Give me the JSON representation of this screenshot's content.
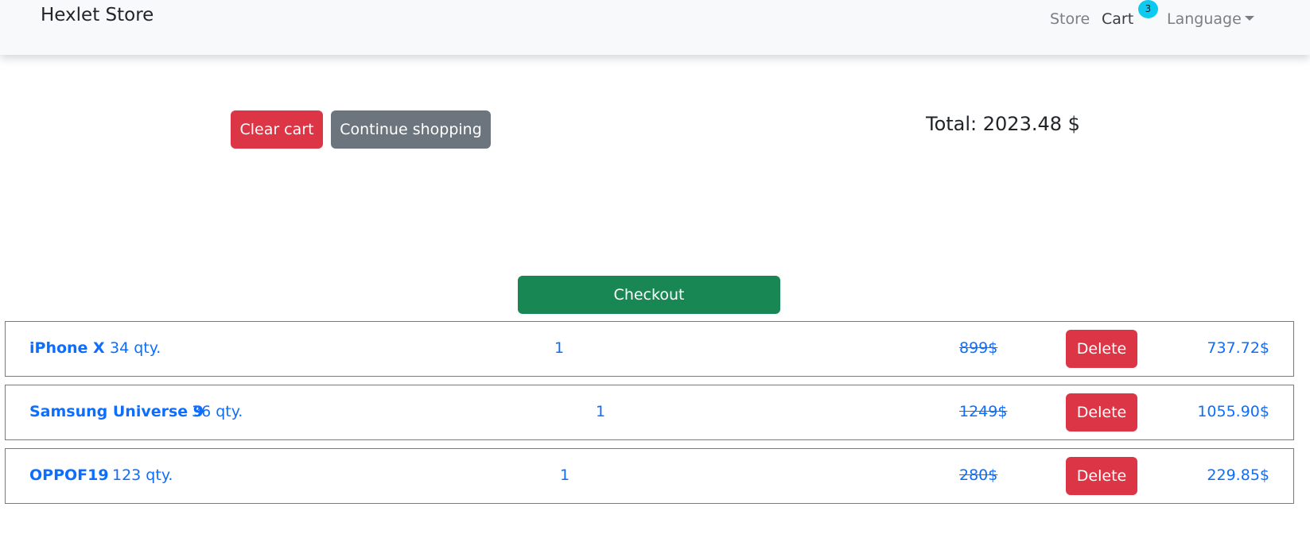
{
  "navbar": {
    "brand": "Hexlet Store",
    "store_link": "Store",
    "cart_link": "Cart",
    "cart_count": "3",
    "language_label": "Language"
  },
  "actions": {
    "clear_cart_label": "Clear cart",
    "continue_shopping_label": "Continue shopping",
    "checkout_label": "Checkout"
  },
  "cart": {
    "total": "Total: 2023.48 $",
    "items": [
      {
        "name": "iPhone X",
        "stock": "34 qty.",
        "count": "1",
        "old_price": "899$",
        "delete_label": "Delete",
        "price": "737.72$"
      },
      {
        "name": "Samsung Universe 9",
        "stock": "36 qty.",
        "count": "1",
        "old_price": "1249$",
        "delete_label": "Delete",
        "price": "1055.90$"
      },
      {
        "name": "OPPOF19",
        "stock": "123 qty.",
        "count": "1",
        "old_price": "280$",
        "delete_label": "Delete",
        "price": "229.85$"
      }
    ]
  },
  "colors": {
    "danger": "#dc3545",
    "secondary": "#6c757d",
    "success": "#198754",
    "info": "#0dcaf0",
    "link": "#0d6efd",
    "navbar_bg": "#f8f9fa"
  }
}
